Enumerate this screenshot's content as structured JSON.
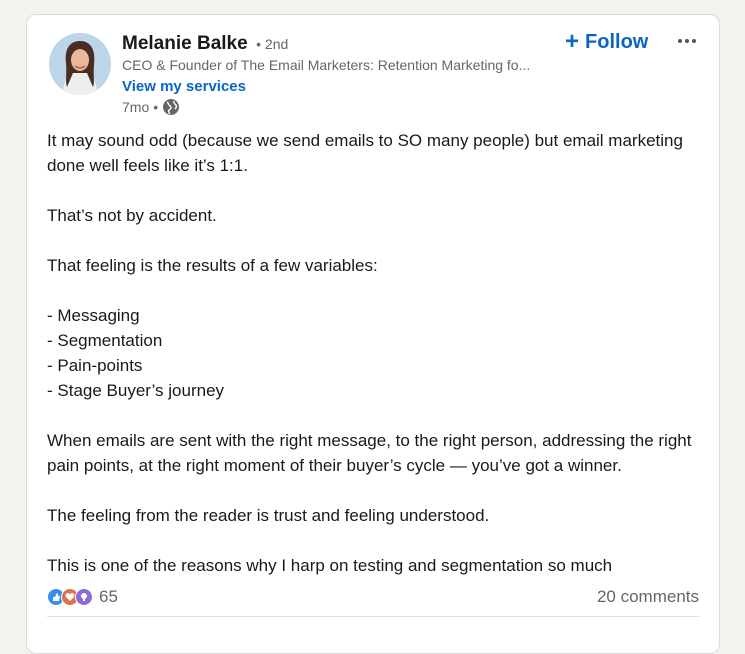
{
  "post": {
    "author": {
      "name": "Melanie Balke",
      "degree": "• 2nd",
      "headline": "CEO & Founder of The Email Marketers: Retention Marketing fo...",
      "services_link": "View my services",
      "time": "7mo",
      "separator": "•",
      "visibility_icon": "globe-icon"
    },
    "actions": {
      "follow_label": "Follow",
      "follow_icon": "plus-icon",
      "more_icon": "more-options-icon"
    },
    "body": {
      "p1": "It may sound odd (because we send emails to SO many people) but email marketing done well feels like it’s 1:1.",
      "p2": "That’s not by accident.",
      "p3": "That feeling is the results of a few variables:",
      "list": [
        "- Messaging",
        "- Segmentation",
        "- Pain-points",
        "- Stage Buyer’s journey"
      ],
      "p4": "When emails are sent with the right message, to the right person, addressing the right pain points, at the right moment of their buyer’s cycle — you’ve got a winner.",
      "p5": "The feeling from the reader is trust and feeling understood.",
      "p6": "This is one of the reasons why I harp on testing and segmentation so much"
    },
    "social": {
      "reaction_icons": [
        "like-icon",
        "love-icon",
        "insightful-icon"
      ],
      "reaction_count": "65",
      "comments": "20 comments"
    },
    "colors": {
      "accent": "#0a66c2",
      "secondary_text": "#666666",
      "background": "#f4f2ee"
    }
  }
}
